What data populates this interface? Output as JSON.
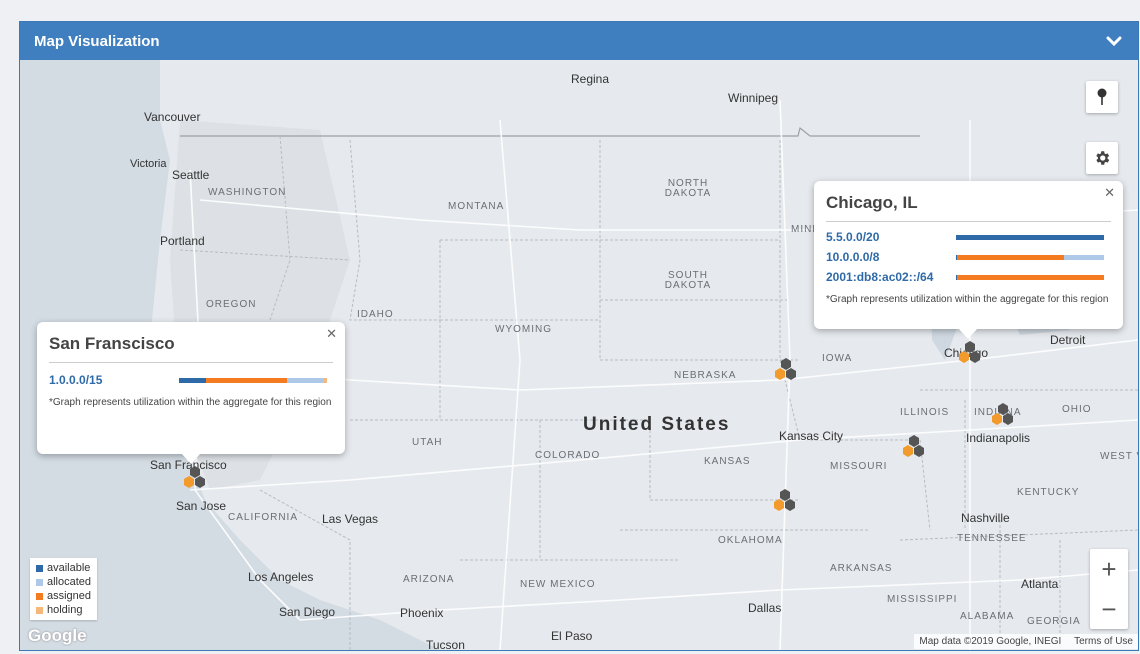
{
  "panel": {
    "title": "Map Visualization"
  },
  "map": {
    "cities": [
      "Regina",
      "Winnipeg",
      "Vancouver",
      "Victoria",
      "Seattle",
      "Portland",
      "Kansas City",
      "Indianapolis",
      "Detroit",
      "Chicago",
      "San Francisco",
      "San Jose",
      "Las Vegas",
      "Los Angeles",
      "San Diego",
      "Phoenix",
      "Tucson",
      "El Paso",
      "Dallas",
      "Atlanta",
      "Nashville"
    ],
    "states": [
      "WASHINGTON",
      "MONTANA",
      "NORTH DAKOTA",
      "SOUTH DAKOTA",
      "OREGON",
      "IDAHO",
      "WYOMING",
      "NEBRASKA",
      "IOWA",
      "ILLINOIS",
      "INDIANA",
      "OHIO",
      "UTAH",
      "COLORADO",
      "KANSAS",
      "MISSOURI",
      "KENTUCKY",
      "CALIFORNIA",
      "OKLAHOMA",
      "TENNESSEE",
      "ARIZONA",
      "NEW MEXICO",
      "ARKANSAS",
      "MISSISSIPPI",
      "ALABAMA",
      "GEORGIA",
      "WEST VIRGINIA",
      "MINNESOTA"
    ],
    "country": "United States"
  },
  "popups": {
    "sf": {
      "title": "San Franscisco",
      "rows": [
        {
          "prefix": "1.0.0.0/15",
          "available": 0.18,
          "assigned": 0.55,
          "allocated": 0.25,
          "holding": 0.02
        }
      ],
      "note": "*Graph represents utilization within the aggregate for this region"
    },
    "chicago": {
      "title": "Chicago, IL",
      "rows": [
        {
          "prefix": "5.5.0.0/20",
          "available": 1.0,
          "assigned": 0,
          "allocated": 0,
          "holding": 0
        },
        {
          "prefix": "10.0.0.0/8",
          "available": 0.01,
          "assigned": 0.72,
          "allocated": 0.27,
          "holding": 0
        },
        {
          "prefix": "2001:db8:ac02::/64",
          "available": 0.01,
          "assigned": 0.99,
          "allocated": 0,
          "holding": 0
        }
      ],
      "note": "*Graph represents utilization within the aggregate for this region"
    }
  },
  "legend": {
    "available": "available",
    "allocated": "allocated",
    "assigned": "assigned",
    "holding": "holding"
  },
  "colors": {
    "available": "#2e6aa8",
    "allocated": "#aec8e8",
    "assigned": "#f47b20",
    "holding": "#f5b87a",
    "header": "#3f7fbf"
  },
  "attribution": {
    "logo": "Google",
    "data": "Map data ©2019 Google, INEGI",
    "terms": "Terms of Use"
  },
  "icons": {
    "collapse": "chevron-down-icon",
    "pin": "map-pin-icon",
    "settings": "gear-icon",
    "zoom_in": "+",
    "zoom_out": "−"
  }
}
